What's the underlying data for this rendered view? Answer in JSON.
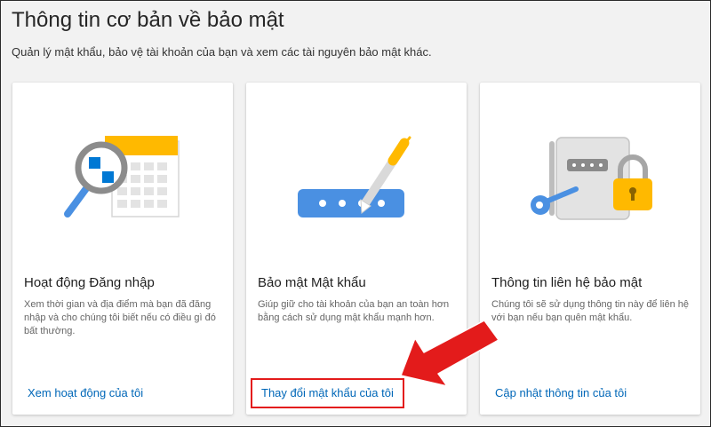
{
  "header": {
    "title": "Thông tin cơ bản về bảo mật",
    "subtitle": "Quản lý mật khẩu, bảo vệ tài khoản của bạn và xem các tài nguyên bảo mật khác."
  },
  "cards": [
    {
      "icon": "sign-in-activity-icon",
      "title": "Hoạt động Đăng nhập",
      "description": "Xem thời gian và địa điểm mà bạn đã đăng nhập và cho chúng tôi biết nếu có điều gì đó bất thường.",
      "link": "Xem hoạt động của tôi"
    },
    {
      "icon": "password-field-pen-icon",
      "title": "Bảo mật Mật khẩu",
      "description": "Giúp giữ cho tài khoản của bạn an toàn hơn bằng cách sử dụng mật khẩu mạnh hơn.",
      "link": "Thay đổi mật khẩu của tôi"
    },
    {
      "icon": "security-info-lock-icon",
      "title": "Thông tin liên hệ bảo mật",
      "description": "Chúng tôi sẽ sử dụng thông tin này để liên hệ với bạn nếu bạn quên mật khẩu.",
      "link": "Cập nhật thông tin của tôi"
    }
  ],
  "annotation": {
    "arrow_icon": "red-arrow-icon",
    "highlight_color": "#e31b1b"
  },
  "colors": {
    "link": "#0067b8",
    "accent_yellow": "#ffb900",
    "accent_blue": "#0078d4",
    "background": "#f2f2f2"
  }
}
